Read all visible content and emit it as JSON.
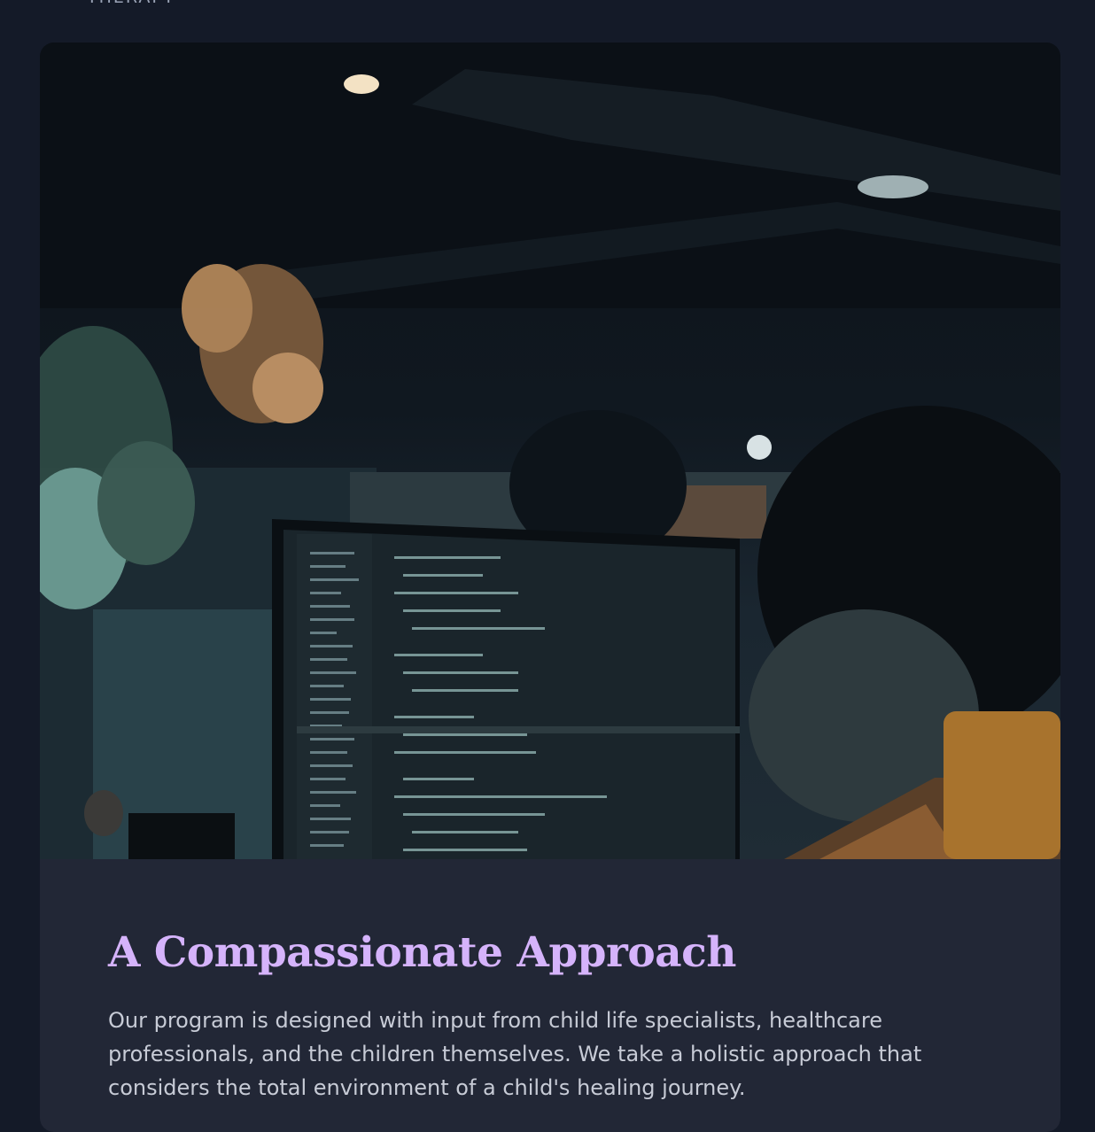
{
  "section": {
    "top_label": "THERAPY"
  },
  "card": {
    "image_alt": "People working at computers in a dimly lit office",
    "title": "A Compassionate Approach",
    "body": "Our program is designed with input from child life specialists, healthcare professionals, and the children themselves. We take a holistic approach that considers the total environment of a child's healing journey."
  },
  "colors": {
    "page_background": "#141a28",
    "card_background": "#222736",
    "title_accent": "#d5b3fb",
    "body_text": "#c7cbd6"
  }
}
